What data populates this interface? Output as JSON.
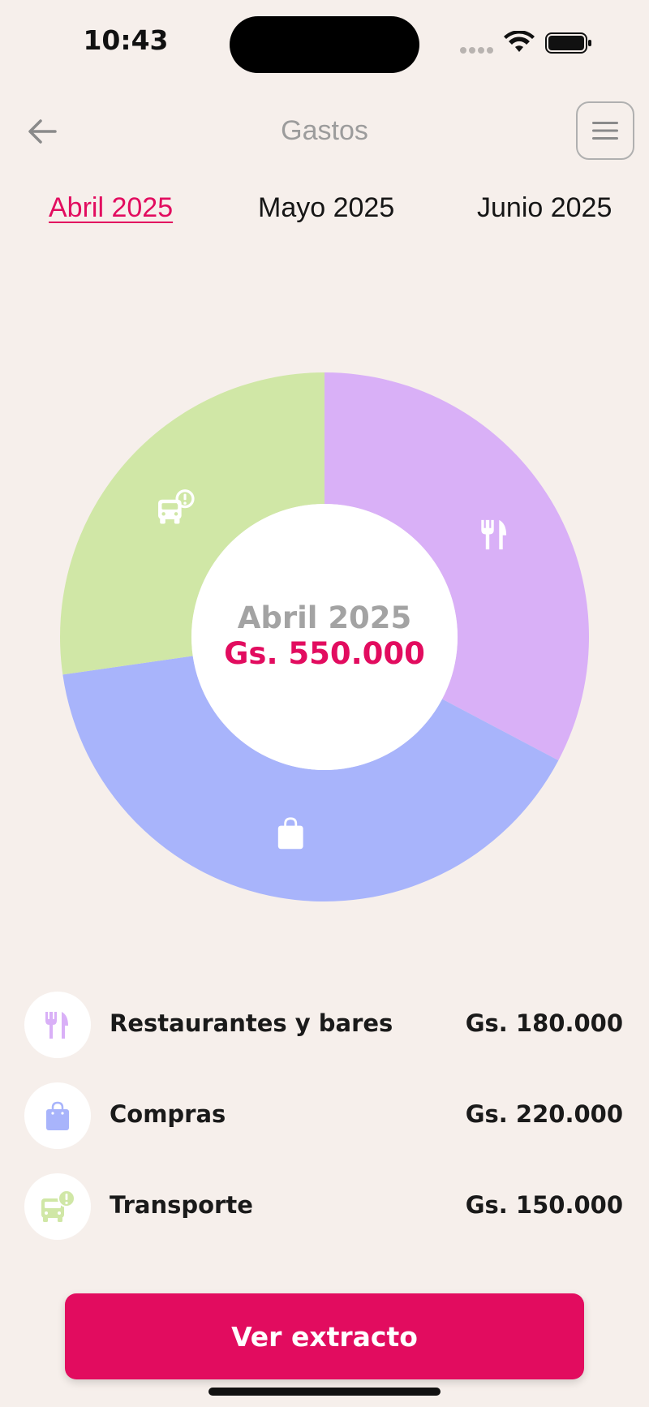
{
  "status_bar": {
    "time": "10:43"
  },
  "header": {
    "title": "Gastos"
  },
  "tabs": [
    {
      "label": "Abril 2025",
      "active": true
    },
    {
      "label": "Mayo 2025",
      "active": false
    },
    {
      "label": "Junio 2025",
      "active": false
    }
  ],
  "summary": {
    "month": "Abril 2025",
    "total": "Gs. 550.000"
  },
  "chart_data": {
    "type": "pie",
    "categories": [
      "Restaurantes y bares",
      "Compras",
      "Transporte"
    ],
    "values": [
      180000,
      220000,
      150000
    ],
    "colors": [
      "#d9b0f7",
      "#a8b4fb",
      "#d0e7a6"
    ],
    "icons": [
      "fork-knife-icon",
      "shopping-bag-icon",
      "bus-alert-icon"
    ]
  },
  "categories": [
    {
      "name": "Restaurantes y bares",
      "amount": "Gs. 180.000",
      "icon": "fork-knife-icon",
      "color": "#d9b0f7"
    },
    {
      "name": "Compras",
      "amount": "Gs. 220.000",
      "icon": "shopping-bag-icon",
      "color": "#a8b4fb"
    },
    {
      "name": "Transporte",
      "amount": "Gs. 150.000",
      "icon": "bus-alert-icon",
      "color": "#d0e7a6"
    }
  ],
  "cta": {
    "label": "Ver extracto"
  },
  "colors": {
    "accent": "#e20c5f",
    "background": "#f6efeb"
  }
}
